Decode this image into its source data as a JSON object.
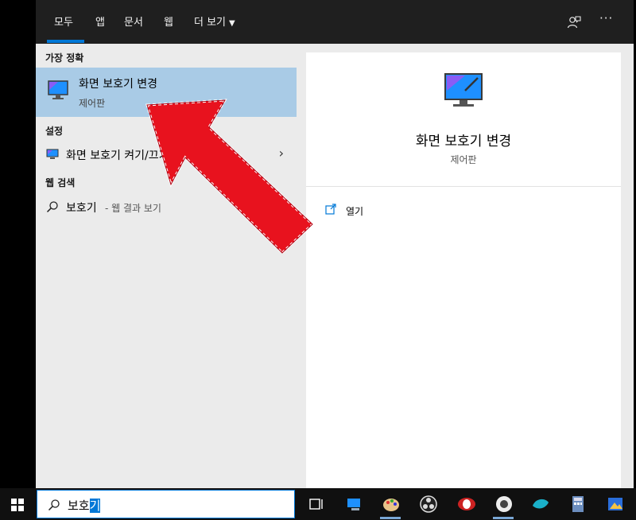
{
  "tabs": [
    "모두",
    "앱",
    "문서",
    "웹",
    "더 보기"
  ],
  "sections": {
    "best": "가장 정확",
    "settings": "설정",
    "web": "웹 검색"
  },
  "best_match": {
    "title": "화면 보호기 변경",
    "subtitle": "제어판"
  },
  "settings_item": {
    "label": "화면 보호기 켜기/끄기"
  },
  "web_item": {
    "query": "보호기",
    "hint": "- 웹 결과 보기"
  },
  "preview": {
    "title": "화면 보호기 변경",
    "subtitle": "제어판",
    "open_label": "열기"
  },
  "search": {
    "typed": "보호",
    "selected": "기"
  },
  "top_icons": {
    "feedback": "person-feedback-icon",
    "more": "···"
  },
  "taskbar": {
    "start_icon": "windows-logo-icon",
    "apps": [
      "task-view-icon",
      "pc-icon",
      "paint-icon",
      "obs-icon",
      "browser-icon",
      "puzzle-app-icon",
      "fish-app-icon",
      "calculator-icon",
      "photo-app-icon"
    ]
  },
  "colors": {
    "accent": "#0078d7",
    "selection": "#a9cbe6",
    "arrow": "#e8121e"
  }
}
